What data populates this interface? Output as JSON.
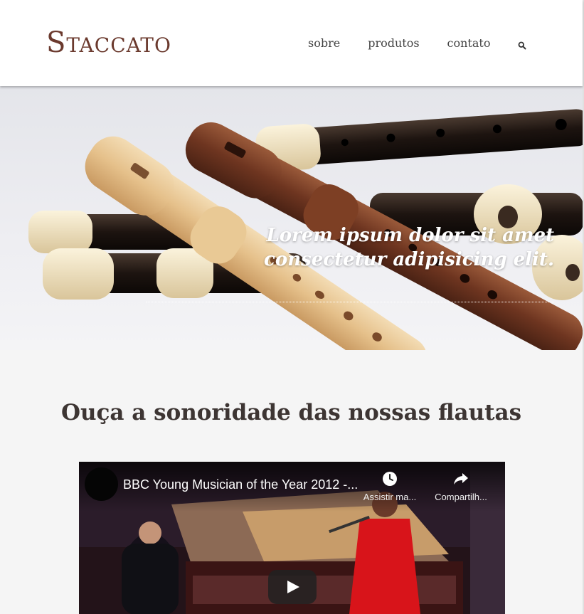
{
  "header": {
    "logo": "Staccato",
    "nav": [
      "sobre",
      "produtos",
      "contato"
    ],
    "search_icon": "search-icon"
  },
  "hero": {
    "quote": "Lorem ipsum dolor sit amet consectetur adipisicing elit."
  },
  "main": {
    "title": "Ouça a sonoridade das nossas flautas",
    "video": {
      "title": "BBC Young Musician of the Year 2012 -...",
      "watch_later_label": "Assistir ma...",
      "share_label": "Compartilh...",
      "watch_later_icon": "clock-icon",
      "share_icon": "share-arrow-icon",
      "play_icon": "play-icon"
    }
  },
  "colors": {
    "brand": "#6b3a2e",
    "nav_text": "#444444",
    "title_text": "#3d3533"
  }
}
